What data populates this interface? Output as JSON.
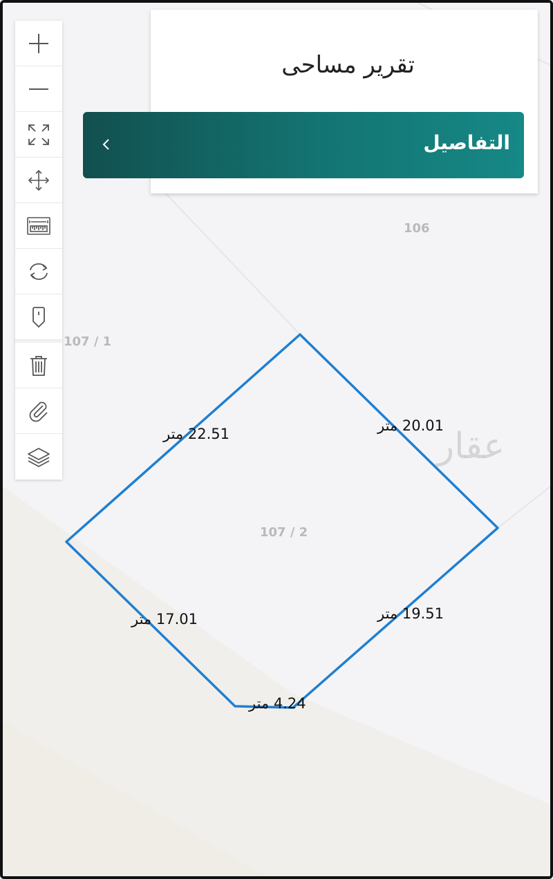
{
  "report": {
    "title": "تقرير مساحى",
    "details_label": "التفاصيل"
  },
  "toolbar": {
    "tools": [
      {
        "name": "zoom-in",
        "icon": "plus-icon"
      },
      {
        "name": "zoom-out",
        "icon": "minus-icon"
      },
      {
        "name": "fit-extent",
        "icon": "expand-icon"
      },
      {
        "name": "pan",
        "icon": "move-arrows-icon"
      },
      {
        "name": "measure",
        "icon": "ruler-icon"
      },
      {
        "name": "refresh",
        "icon": "refresh-icon"
      },
      {
        "name": "marker",
        "icon": "map-pin-icon"
      },
      {
        "name": "delete",
        "icon": "trash-icon"
      },
      {
        "name": "attach",
        "icon": "paperclip-icon"
      },
      {
        "name": "layers",
        "icon": "layers-icon"
      }
    ]
  },
  "map": {
    "parcels": {
      "north": "106",
      "west": "107 / 1",
      "selected": "107 / 2"
    },
    "edges": {
      "north_west": "22.51 متر",
      "north_east": "20.01 متر",
      "south_west": "17.01 متر",
      "south_east": "19.51 متر",
      "south": "4.24 متر"
    },
    "watermark": "عقار",
    "outline_color": "#1f7fd1"
  },
  "colors": {
    "accent": "#137573",
    "accent_dark": "#12504f"
  }
}
